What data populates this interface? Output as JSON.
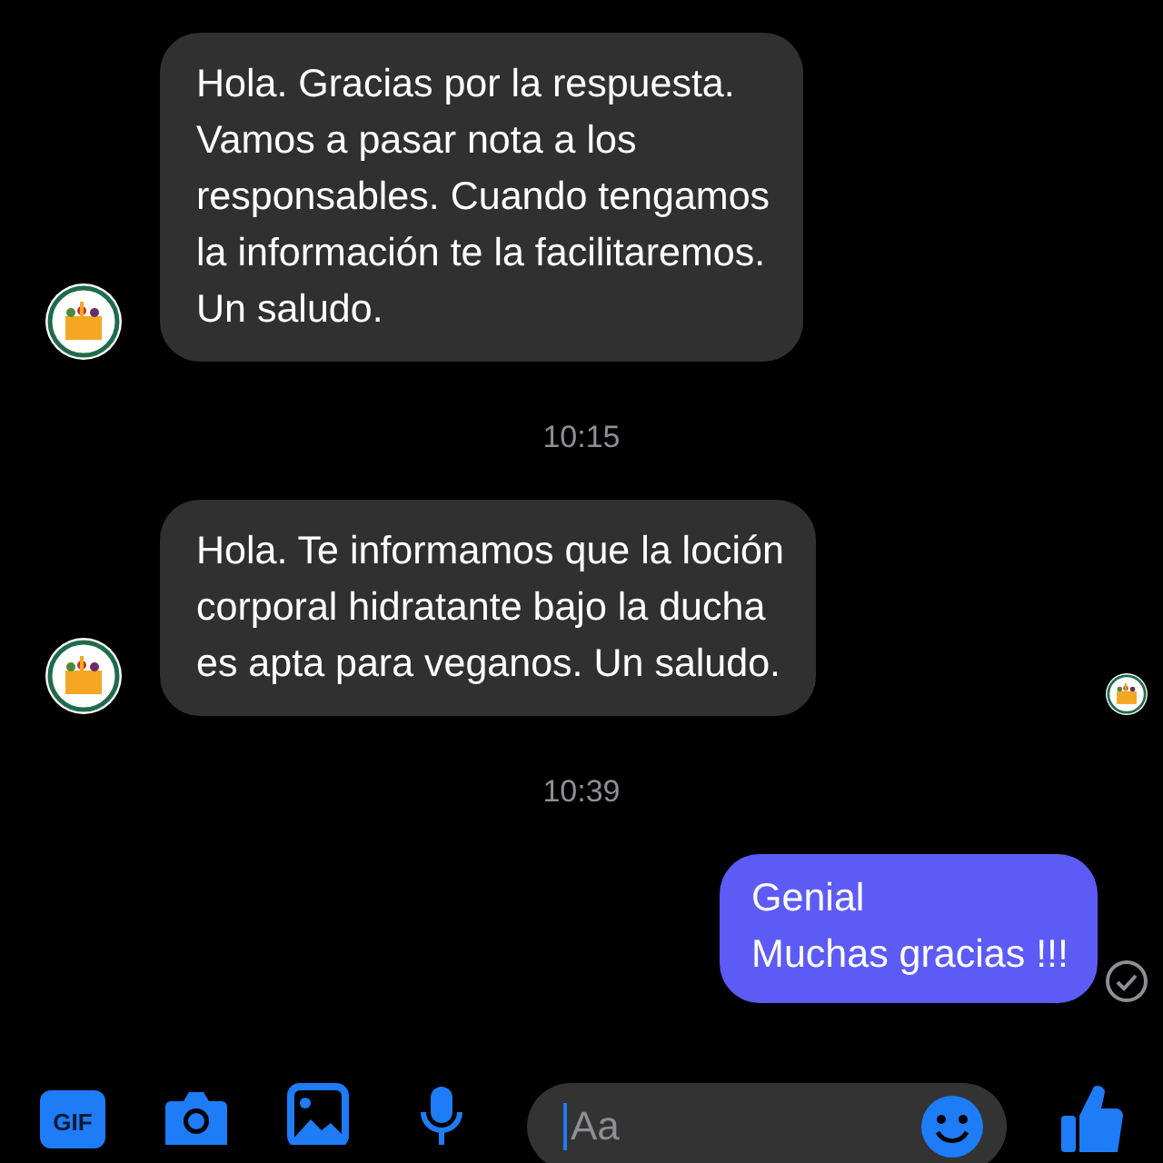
{
  "messages": [
    {
      "kind": "incoming",
      "lines": [
        "Hola. Gracias por la respuesta.",
        "Vamos a pasar nota a los",
        "responsables. Cuando tengamos",
        "la información te la facilitaremos.",
        "Un saludo."
      ]
    },
    {
      "kind": "time",
      "text": "10:15"
    },
    {
      "kind": "incoming",
      "lines": [
        "Hola. Te informamos que la loción",
        "corporal hidratante bajo la ducha",
        "es apta para veganos. Un saludo."
      ],
      "seen": true
    },
    {
      "kind": "time",
      "text": "10:39"
    },
    {
      "kind": "outgoing",
      "lines": [
        "Genial",
        "Muchas gracias !!!"
      ],
      "delivered": true
    }
  ],
  "composer": {
    "gif_label": "GIF",
    "placeholder": "Aa"
  }
}
